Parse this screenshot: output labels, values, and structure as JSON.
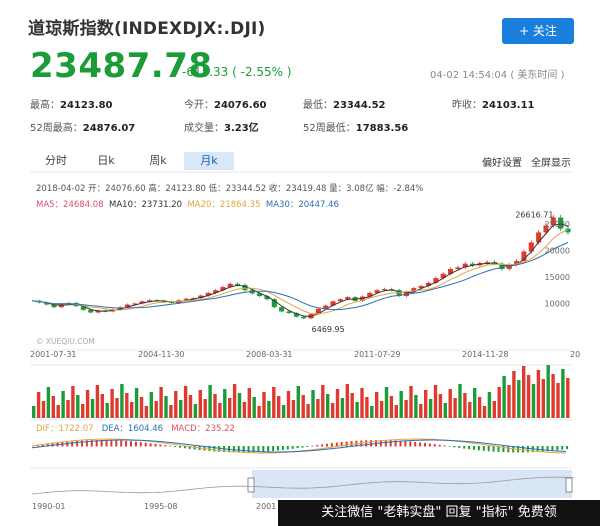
{
  "header": {
    "title": "道琼斯指数(INDEXDJX:.DJI)",
    "follow_label": "+ 关注",
    "price": "23487.78",
    "change": "-615.33 ( -2.55% )",
    "timestamp": "04-02 14:54:04 ( 美东时间 )"
  },
  "stats": [
    {
      "label": "最高：",
      "value": "24123.80"
    },
    {
      "label": "今开：",
      "value": "24076.60"
    },
    {
      "label": "最低：",
      "value": "23344.52"
    },
    {
      "label": "昨收：",
      "value": "24103.11"
    },
    {
      "label": "52周最高：",
      "value": "24876.07"
    },
    {
      "label": "成交量：",
      "value": "3.23亿"
    },
    {
      "label": "52周最低：",
      "value": "17883.56"
    }
  ],
  "tabs": [
    "分时",
    "日k",
    "周k",
    "月k"
  ],
  "active_tab": "月k",
  "links": {
    "preference": "偏好设置",
    "fullscreen": "全屏显示"
  },
  "chart_info": {
    "ohlc_line": "2018-04-02 开：24076.60 高：24123.80 低：23344.52 收：23419.48 量：3.08亿 幅：-2.84%",
    "ma5": "MA5：24684.08",
    "ma10": "MA10：23731.20",
    "ma20": "MA20：21864.35",
    "ma30": "MA30：20447.46",
    "watermark": "© XUEQIU.COM",
    "macd_line": {
      "dif": "DIF：1722.07",
      "dea": "DEA：1604.46",
      "macd": "MACD：235.22"
    }
  },
  "colors": {
    "up": "#e03a2f",
    "down": "#1a9c38",
    "accent": "#1a7fdc",
    "ma5": "#e04e6d",
    "ma10": "#333333",
    "ma20": "#e3a640",
    "ma30": "#2a6fb8"
  },
  "chart_data": {
    "type": "line",
    "x_ticks": [
      "2001-07-31",
      "2004-11-30",
      "2008-03-31",
      "2011-07-29",
      "2014-11-28",
      "20"
    ],
    "y_ticks": [
      "25000",
      "20000",
      "15000",
      "10000"
    ],
    "ylim": [
      5000,
      28000
    ],
    "annotations": [
      {
        "label": "26616.71",
        "value": 26616.71
      },
      {
        "label": "6469.95",
        "value": 6469.95
      }
    ],
    "navigator_ticks": [
      "1990-01",
      "1995-08",
      "2001"
    ],
    "series": [
      {
        "values": [
          10500,
          10200,
          9800,
          9300,
          9900,
          10100,
          9500,
          8800,
          8300,
          8700,
          8500,
          8900,
          9300,
          9800,
          10000,
          10400,
          10600,
          10500,
          10300,
          10100,
          10600,
          10900,
          11000,
          11500,
          12000,
          12500,
          13100,
          13700,
          13500,
          12500,
          11900,
          11400,
          10800,
          9300,
          8500,
          8200,
          7500,
          7200,
          8000,
          9000,
          9600,
          10400,
          10800,
          11200,
          10500,
          11300,
          12000,
          12500,
          12700,
          12500,
          11400,
          12200,
          12900,
          13300,
          13900,
          14800,
          15600,
          16500,
          16800,
          17500,
          17200,
          17600,
          17800,
          17500,
          16500,
          17300,
          18000,
          19800,
          21500,
          23400,
          24700,
          26200,
          24100,
          23400
        ]
      }
    ]
  },
  "footer_banner": "关注微信 \"老韩实盘\" 回复 \"指标\" 免费领"
}
